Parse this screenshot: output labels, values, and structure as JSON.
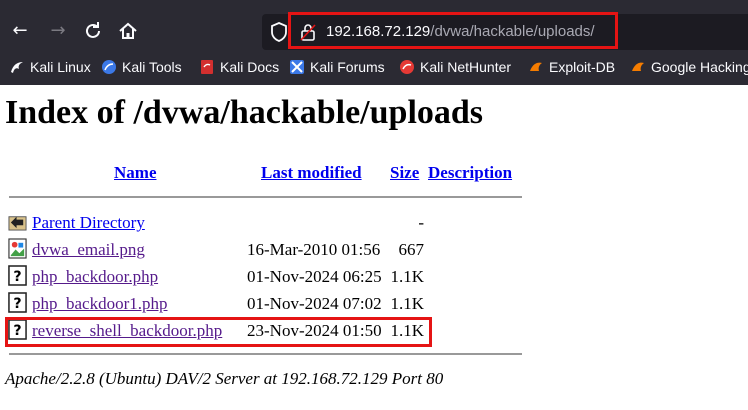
{
  "browser": {
    "url_host": "192.168.72.129",
    "url_path": "/dvwa/hackable/uploads/",
    "bookmarks": [
      {
        "label": "Kali Linux",
        "icon": "kali-dragon-icon"
      },
      {
        "label": "Kali Tools",
        "icon": "kali-tools-icon"
      },
      {
        "label": "Kali Docs",
        "icon": "kali-docs-icon"
      },
      {
        "label": "Kali Forums",
        "icon": "kali-forums-icon"
      },
      {
        "label": "Kali NetHunter",
        "icon": "nethunter-icon"
      },
      {
        "label": "Exploit-DB",
        "icon": "exploit-db-icon"
      },
      {
        "label": "Google Hacking",
        "icon": "google-hacking-icon"
      }
    ]
  },
  "page": {
    "title": "Index of /dvwa/hackable/uploads",
    "columns": {
      "name": "Name",
      "last_modified": "Last modified",
      "size": "Size",
      "description": "Description"
    },
    "rows": [
      {
        "name": "Parent Directory",
        "date": "",
        "size": "-",
        "icon": "back-folder-icon"
      },
      {
        "name": "dvwa_email.png",
        "date": "16-Mar-2010 01:56",
        "size": "667",
        "icon": "image-file-icon"
      },
      {
        "name": "php_backdoor.php",
        "date": "01-Nov-2024 06:25",
        "size": "1.1K",
        "icon": "unknown-file-icon"
      },
      {
        "name": "php_backdoor1.php",
        "date": "01-Nov-2024 07:02",
        "size": "1.1K",
        "icon": "unknown-file-icon"
      },
      {
        "name": "reverse_shell_backdoor.php",
        "date": "23-Nov-2024 01:50",
        "size": "1.1K",
        "icon": "unknown-file-icon"
      }
    ],
    "footer": "Apache/2.2.8 (Ubuntu) DAV/2 Server at 192.168.72.129 Port 80"
  },
  "colors": {
    "highlight": "#e51414",
    "chrome_bg": "#2b2a33",
    "link_visited": "#551a8b",
    "link": "#0000ee"
  }
}
